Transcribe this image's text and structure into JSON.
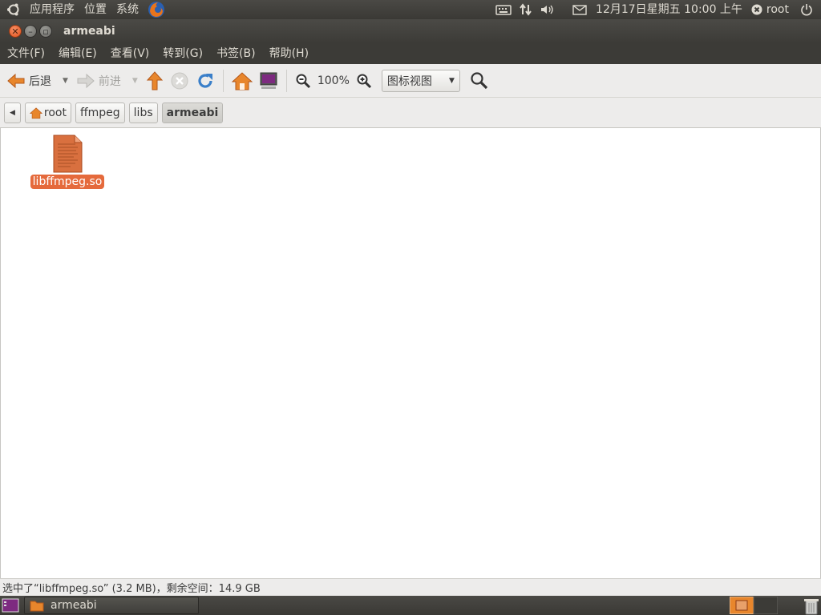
{
  "panel": {
    "menus": [
      "应用程序",
      "位置",
      "系统"
    ],
    "clock": "12月17日星期五 10:00 上午",
    "user": "root"
  },
  "window": {
    "title": "armeabi"
  },
  "menubar": [
    "文件(F)",
    "编辑(E)",
    "查看(V)",
    "转到(G)",
    "书签(B)",
    "帮助(H)"
  ],
  "toolbar": {
    "back": "后退",
    "forward": "前进",
    "zoom": "100%",
    "view_mode": "图标视图"
  },
  "pathbar": [
    "root",
    "ffmpeg",
    "libs",
    "armeabi"
  ],
  "files": [
    {
      "name": "libffmpeg.so",
      "selected": true
    }
  ],
  "status": "选中了“libffmpeg.so” (3.2 MB)，剩余空间：14.9 GB",
  "taskbar": {
    "task": "armeabi"
  },
  "colors": {
    "accent": "#e56a3c",
    "panel": "#3c3b37"
  }
}
